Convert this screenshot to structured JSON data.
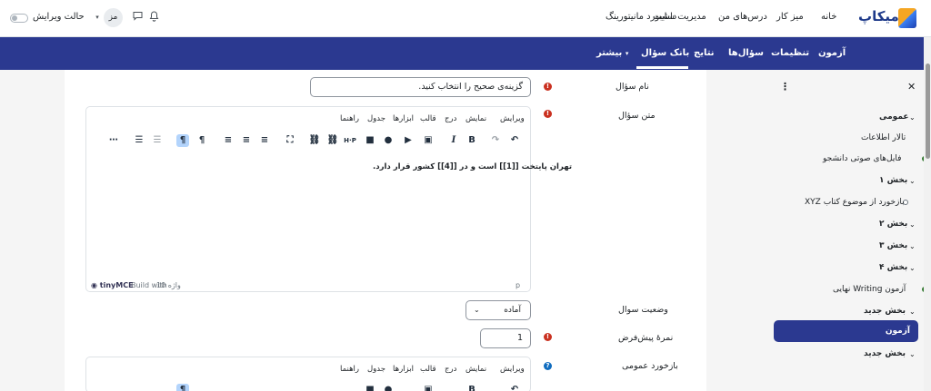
{
  "header": {
    "logo_text": "میکاپ",
    "nav_links": [
      "خانه",
      "میز کار",
      "درس‌های من",
      "مدیریت سایت",
      "داشبورد مانیتورینگ"
    ],
    "avatar": "مز",
    "edit_mode_label": "حالت ویرایش"
  },
  "secondary_nav": {
    "tabs": [
      "آزمون",
      "تنظیمات",
      "سؤال‌ها",
      "نتایج",
      "بانک سؤال",
      "بیشتر"
    ],
    "active": "بانک سؤال"
  },
  "drawer": {
    "items": [
      {
        "label": "عمومی",
        "type": "section"
      },
      {
        "label": "تالار اطلاعات",
        "type": "activity"
      },
      {
        "label": "فایل‌های صوتی دانشجو",
        "type": "activity-complete"
      },
      {
        "label": "بخش ۱",
        "type": "section"
      },
      {
        "label": "بازخورد از موضوع کتاب XYZ",
        "type": "activity-open"
      },
      {
        "label": "بخش ۲",
        "type": "section"
      },
      {
        "label": "بخش ۳",
        "type": "section"
      },
      {
        "label": "بخش ۴",
        "type": "section"
      },
      {
        "label": "آزمون Writing نهایی",
        "type": "activity-complete"
      },
      {
        "label": "بخش جدید",
        "type": "section"
      },
      {
        "label": "آزمون",
        "type": "active"
      },
      {
        "label": "بخش جدید",
        "type": "section"
      }
    ]
  },
  "form": {
    "question_name_label": "نام سؤال",
    "question_name_value": "گزینه‌ی صحیح را انتخاب کنید.",
    "question_text_label": "متن سؤال",
    "menubar": [
      "ویرایش",
      "نمایش",
      "درج",
      "قالب",
      "ابزارها",
      "جدول",
      "راهنما"
    ],
    "editor_content": "تهران پایتخت [[1]] است و در [[4]] کشور قرار دارد.",
    "status_path": "p",
    "word_count": "10 واژه",
    "build_with": "Build with",
    "tinymce": "tinyMCE",
    "status_label": "وضعیت سوال",
    "status_value": "آماده",
    "default_mark_label": "نمرهٔ پیش‌فرض",
    "default_mark_value": "1",
    "general_feedback_label": "بازخورد عمومی"
  }
}
